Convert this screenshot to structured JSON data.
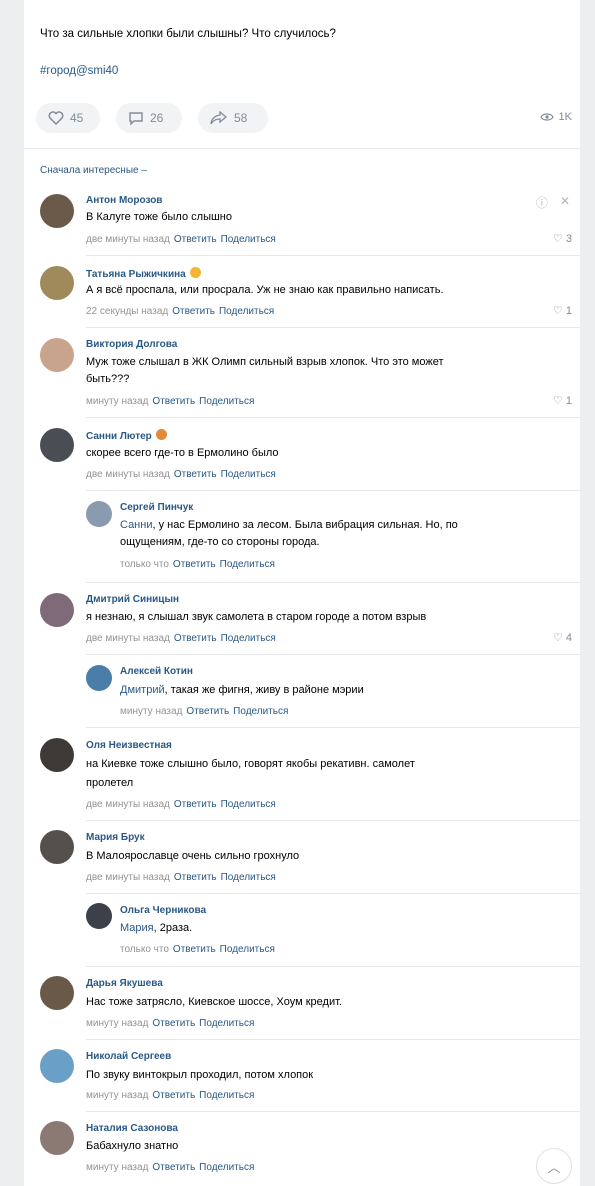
{
  "post": {
    "text": "Что за сильные хлопки были слышны? Что случилось?",
    "hashtag": "#город@smi40",
    "likes": "45",
    "comments": "26",
    "shares": "58",
    "views": "1K"
  },
  "sort_label": "Сначала интересные –",
  "comments": [
    {
      "name": "Антон Морозов",
      "text": "В Калуге тоже было слышно",
      "time": "две минуты назад",
      "reply": "Ответить",
      "share": "Поделиться",
      "likes": "3"
    },
    {
      "name": "Татьяна Рыжичкина",
      "text": "А я всё проспала, или просрала. Уж не знаю как правильно написать.",
      "time": "22 секунды назад",
      "reply": "Ответить",
      "share": "Поделиться",
      "likes": "1"
    },
    {
      "name": "Виктория Долгова",
      "text_line1": "Муж тоже слышал в ЖК Олимп сильный взрыв хлопок. Что это может",
      "text_line2": "быть???",
      "time": "минуту назад",
      "reply": "Ответить",
      "share": "Поделиться",
      "likes": "1"
    },
    {
      "name": "Санни Лютер",
      "text": "скорее всего где-то в Ермолино было",
      "time": "две минуты назад",
      "reply": "Ответить",
      "share": "Поделиться"
    },
    {
      "name": "Сергей Пинчук",
      "mention": "Санни",
      "text_line1": ", у нас Ермолино за лесом. Была вибрация сильная. Но, по",
      "text_line2": "ощущениям, где-то со стороны города.",
      "time": "только что",
      "reply": "Ответить",
      "share": "Поделиться"
    },
    {
      "name": "Дмитрий Синицын",
      "text": "я незнаю, я слышал звук самолета в старом городе а потом взрыв",
      "time": "две минуты назад",
      "reply": "Ответить",
      "share": "Поделиться",
      "likes": "4"
    },
    {
      "name": "Алексей Котин",
      "mention": "Дмитрий",
      "text": ", такая же фигня, живу в районе мэрии",
      "time": "минуту назад",
      "reply": "Ответить",
      "share": "Поделиться"
    },
    {
      "name": "Оля Неизвестная",
      "text_line1": "на Киевке тоже слышно было, говорят якобы рекативн. самолет",
      "text_line2": "пролетел",
      "time": "две минуты назад",
      "reply": "Ответить",
      "share": "Поделиться"
    },
    {
      "name": "Мария Брук",
      "text": "В Малоярославце очень сильно грохнуло",
      "time": "две минуты назад",
      "reply": "Ответить",
      "share": "Поделиться"
    },
    {
      "name": "Ольга Черникова",
      "mention": "Мария",
      "text": ", 2раза.",
      "time": "только что",
      "reply": "Ответить",
      "share": "Поделиться"
    },
    {
      "name": "Дарья Якушева",
      "text": "Нас тоже затрясло, Киевское шоссе, Хоум кредит.",
      "time": "минуту назад",
      "reply": "Ответить",
      "share": "Поделиться"
    },
    {
      "name": "Николай Сергеев",
      "text": "По звуку винтокрыл проходил, потом хлопок",
      "time": "минуту назад",
      "reply": "Ответить",
      "share": "Поделиться"
    },
    {
      "name": "Наталия Сазонова",
      "text": "Бабахнуло знатно",
      "time": "минуту назад",
      "reply": "Ответить",
      "share": "Поделиться"
    }
  ],
  "colors": {
    "link": "#2a5885",
    "meta": "#939393",
    "bg": "#edeef0"
  },
  "icons": [
    "heart-icon",
    "comment-icon",
    "share-icon",
    "eye-icon",
    "info-icon",
    "close-icon",
    "chevron-up-icon"
  ]
}
